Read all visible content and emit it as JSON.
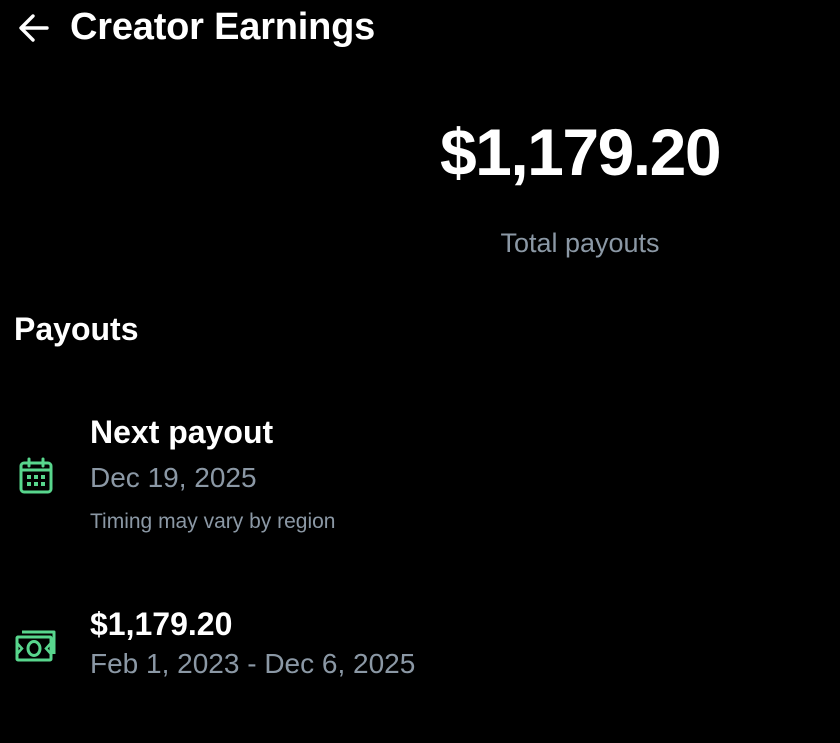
{
  "header": {
    "title": "Creator Earnings",
    "back_icon": "arrow-left-icon"
  },
  "summary": {
    "total_amount": "$1,179.20",
    "total_label": "Total payouts"
  },
  "payouts": {
    "section_title": "Payouts",
    "next_payout": {
      "icon": "calendar-icon",
      "title": "Next payout",
      "date": "Dec 19, 2025",
      "note": "Timing may vary by region"
    },
    "history_item": {
      "icon": "money-icon",
      "amount": "$1,179.20",
      "date_range": "Feb 1, 2023 - Dec 6, 2025"
    }
  },
  "colors": {
    "background": "#000000",
    "primary_text": "#ffffff",
    "secondary_text": "#8b98a5",
    "icon_accent": "#58d68d"
  }
}
